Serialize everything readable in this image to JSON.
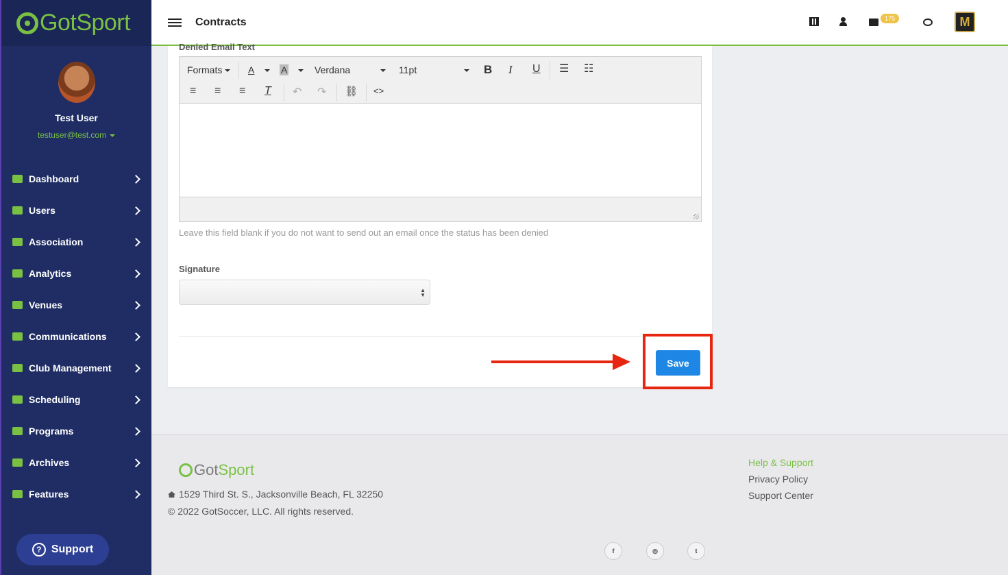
{
  "brand": {
    "name_a": "Got",
    "name_b": "Sport",
    "accent": "#7ac143",
    "sidebar_bg": "#1f2d64",
    "save_color": "#1e87e5",
    "annotation_color": "#e8250f"
  },
  "header": {
    "title": "Contracts",
    "mail_count": "175",
    "org_logo_letter": "M"
  },
  "profile": {
    "name": "Test User",
    "email": "testuser@test.com"
  },
  "sidebar": {
    "items": [
      {
        "label": "Dashboard",
        "icon": "dashboard-icon"
      },
      {
        "label": "Users",
        "icon": "users-icon"
      },
      {
        "label": "Association",
        "icon": "sitemap-icon"
      },
      {
        "label": "Analytics",
        "icon": "chart-icon"
      },
      {
        "label": "Venues",
        "icon": "home-icon"
      },
      {
        "label": "Communications",
        "icon": "comments-icon"
      },
      {
        "label": "Club Management",
        "icon": "list-icon"
      },
      {
        "label": "Scheduling",
        "icon": "calendar-icon"
      },
      {
        "label": "Programs",
        "icon": "file-icon"
      },
      {
        "label": "Archives",
        "icon": "archive-icon"
      },
      {
        "label": "Features",
        "icon": "star-icon"
      }
    ],
    "support_label": "Support"
  },
  "form": {
    "cut_label": "Denied Email Text",
    "toolbar": {
      "formats": "Formats",
      "font": "Verdana",
      "size": "11pt"
    },
    "help_text": "Leave this field blank if you do not want to send out an email once the status has been denied",
    "signature_label": "Signature",
    "signature_value": "",
    "save_label": "Save"
  },
  "footer": {
    "address": "1529 Third St. S., Jacksonville Beach, FL 32250",
    "copyright": "© 2022 GotSoccer, LLC. All rights reserved.",
    "links": [
      "Help & Support",
      "Privacy Policy",
      "Support Center"
    ],
    "social": [
      "facebook-icon",
      "instagram-icon",
      "twitter-icon"
    ]
  }
}
